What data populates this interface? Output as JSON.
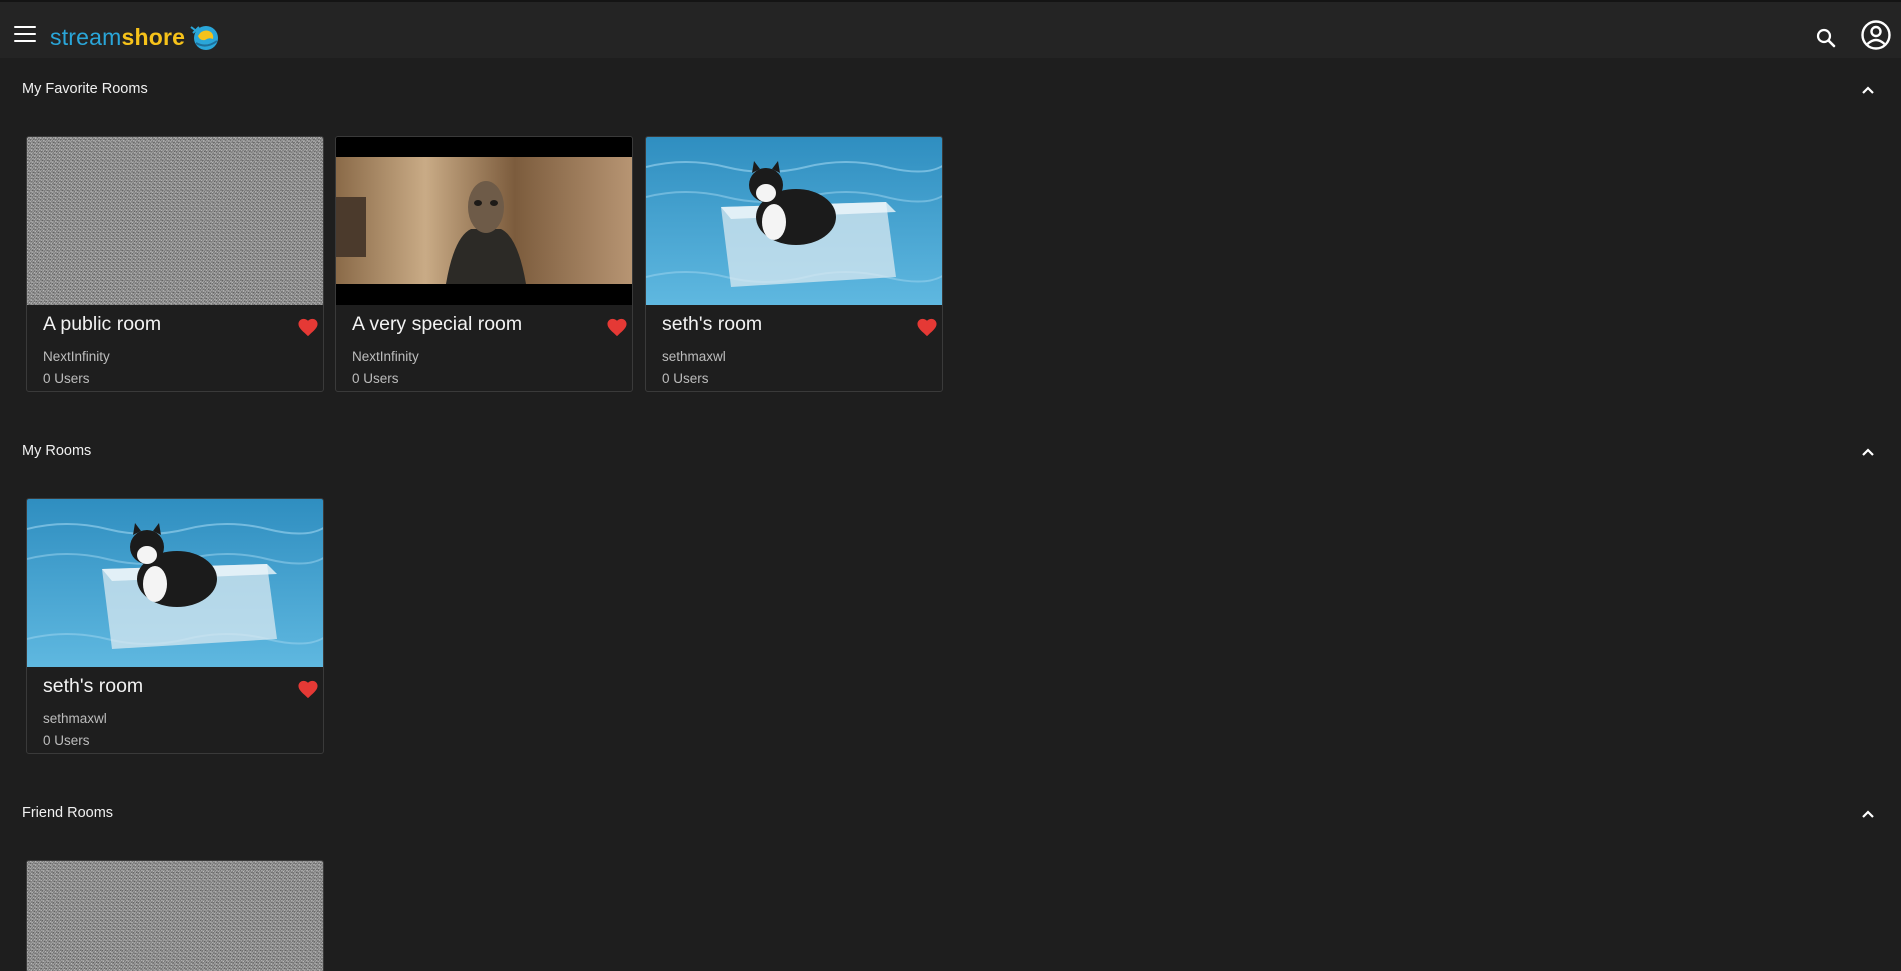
{
  "app": {
    "logo_part1": "stream",
    "logo_part2": "shore"
  },
  "icons": {
    "menu": "menu-icon",
    "search": "search-icon",
    "account": "account-circle-icon",
    "collapse": "chevron-up-icon",
    "favorite": "heart-icon"
  },
  "colors": {
    "background": "#1e1e1e",
    "appbar": "#242424",
    "logo_blue": "#2aa6d9",
    "logo_yellow": "#f6c21a",
    "favorite": "#e53935"
  },
  "sections": [
    {
      "title": "My Favorite Rooms",
      "rooms": [
        {
          "name": "A public room",
          "owner": "NextInfinity",
          "users": "0 Users",
          "thumbnail": "static-noise"
        },
        {
          "name": "A very special room",
          "owner": "NextInfinity",
          "users": "0 Users",
          "thumbnail": "alien-figure"
        },
        {
          "name": "seth's room",
          "owner": "sethmaxwl",
          "users": "0 Users",
          "thumbnail": "cat-in-box-on-water"
        }
      ]
    },
    {
      "title": "My Rooms",
      "rooms": [
        {
          "name": "seth's room",
          "owner": "sethmaxwl",
          "users": "0 Users",
          "thumbnail": "cat-in-box-on-water"
        }
      ]
    },
    {
      "title": "Friend Rooms",
      "rooms": [
        {
          "thumbnail": "static-noise"
        }
      ]
    }
  ]
}
